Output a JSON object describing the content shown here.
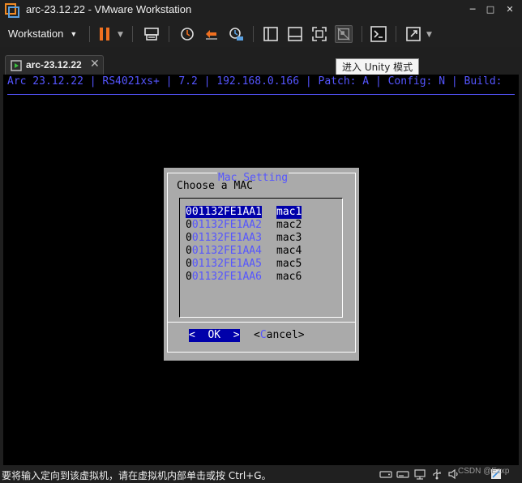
{
  "window": {
    "title": "arc-23.12.22 - VMware Workstation",
    "minimize": "─",
    "maximize": "□",
    "close": "✕"
  },
  "toolbar": {
    "menu_label": "Workstation",
    "menu_caret": "▼",
    "icons": [
      "pause-icon",
      "send-keys-icon",
      "snapshot-icon",
      "revert-snapshot-icon",
      "snapshot-manager-icon",
      "library-icon",
      "single-window-icon",
      "full-screen-icon",
      "unity-icon",
      "console-view-icon",
      "stretch-icon"
    ],
    "accent_pause": "#f07020"
  },
  "tabs": [
    {
      "label": "arc-23.12.22",
      "close": "✕"
    }
  ],
  "tooltip": {
    "text": "进入 Unity 模式"
  },
  "console": {
    "header": "Arc 23.12.22 | RS4021xs+ | 7.2 | 192.168.0.166 | Patch: A | Config: N | Build:",
    "dialog": {
      "title": "Mac Setting",
      "prompt": "Choose a MAC",
      "items": [
        {
          "first": "0",
          "rest": "01132FE1AA1",
          "tag": "mac1",
          "selected": true
        },
        {
          "first": "0",
          "rest": "01132FE1AA2",
          "tag": "mac2",
          "selected": false
        },
        {
          "first": "0",
          "rest": "01132FE1AA3",
          "tag": "mac3",
          "selected": false
        },
        {
          "first": "0",
          "rest": "01132FE1AA4",
          "tag": "mac4",
          "selected": false
        },
        {
          "first": "0",
          "rest": "01132FE1AA5",
          "tag": "mac5",
          "selected": false
        },
        {
          "first": "0",
          "rest": "01132FE1AA6",
          "tag": "mac6",
          "selected": false
        }
      ],
      "ok_label": "<  OK  >",
      "cancel_left": "<",
      "cancel_hot": "C",
      "cancel_rest": "ancel>"
    },
    "colors": {
      "background": "#000000",
      "text_blue": "#5555ff",
      "dialog_gray": "#aaaaaa",
      "highlight": "#0000aa"
    }
  },
  "statusbar": {
    "message": "要将输入定向到该虚拟机，请在虚拟机内部单击或按 Ctrl+G。",
    "watermark": "CSDN @Ezxp"
  }
}
